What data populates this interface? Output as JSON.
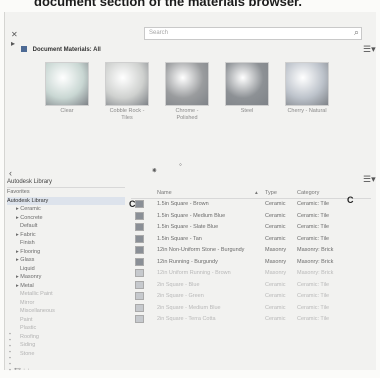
{
  "caption": "document section of the materials browser.",
  "search": {
    "placeholder": "Search"
  },
  "doc_section": {
    "title": "Document Materials: All"
  },
  "doc_materials": [
    {
      "name": "Clear",
      "color": "#c9d7d3"
    },
    {
      "name": "Cobble Rock - Tiles",
      "color": "#cfd1cf"
    },
    {
      "name": "Chrome - Polished",
      "color": "#9a9c9e"
    },
    {
      "name": "Steel",
      "color": "#8d9195"
    },
    {
      "name": "Cherry - Natural",
      "color": "#bdc3cb"
    }
  ],
  "library": {
    "title": "Autodesk Library",
    "tree": [
      {
        "label": "Favorites",
        "indent": 0,
        "selected": false,
        "faded": false
      },
      {
        "label": "Autodesk Library",
        "indent": 0,
        "selected": true,
        "faded": false
      },
      {
        "label": "▸ Ceramic",
        "indent": 1,
        "selected": false,
        "faded": false
      },
      {
        "label": "▸ Concrete",
        "indent": 1,
        "selected": false,
        "faded": false
      },
      {
        "label": "Default",
        "indent": 2,
        "selected": false,
        "faded": false
      },
      {
        "label": "▸ Fabric",
        "indent": 1,
        "selected": false,
        "faded": false
      },
      {
        "label": "Finish",
        "indent": 2,
        "selected": false,
        "faded": false
      },
      {
        "label": "▸ Flooring",
        "indent": 1,
        "selected": false,
        "faded": false
      },
      {
        "label": "▸ Glass",
        "indent": 1,
        "selected": false,
        "faded": false
      },
      {
        "label": "Liquid",
        "indent": 2,
        "selected": false,
        "faded": false
      },
      {
        "label": "▸ Masonry",
        "indent": 1,
        "selected": false,
        "faded": false
      },
      {
        "label": "▸ Metal",
        "indent": 1,
        "selected": false,
        "faded": false
      },
      {
        "label": "Metallic Paint",
        "indent": 2,
        "selected": false,
        "faded": true
      },
      {
        "label": "Mirror",
        "indent": 2,
        "selected": false,
        "faded": true
      },
      {
        "label": "Miscellaneous",
        "indent": 2,
        "selected": false,
        "faded": true
      },
      {
        "label": "Paint",
        "indent": 2,
        "selected": false,
        "faded": true
      },
      {
        "label": "Plastic",
        "indent": 2,
        "selected": false,
        "faded": true
      },
      {
        "label": "Roofing",
        "indent": 2,
        "selected": false,
        "faded": true
      },
      {
        "label": "Siding",
        "indent": 2,
        "selected": false,
        "faded": true
      },
      {
        "label": "Stone",
        "indent": 2,
        "selected": false,
        "faded": true
      }
    ]
  },
  "columns": {
    "name": "Name",
    "type": "Type",
    "category": "Category"
  },
  "rows": [
    {
      "name": "1.5in Square - Brown",
      "type": "Ceramic",
      "category": "Ceramic: Tile",
      "faded": false
    },
    {
      "name": "1.5in Square - Medium Blue",
      "type": "Ceramic",
      "category": "Ceramic: Tile",
      "faded": false
    },
    {
      "name": "1.5in Square - Slate Blue",
      "type": "Ceramic",
      "category": "Ceramic: Tile",
      "faded": false
    },
    {
      "name": "1.5in Square - Tan",
      "type": "Ceramic",
      "category": "Ceramic: Tile",
      "faded": false
    },
    {
      "name": "12in Non-Uniform Stone - Burgundy",
      "type": "Masonry",
      "category": "Masonry: Brick",
      "faded": false
    },
    {
      "name": "12in Running - Burgundy",
      "type": "Masonry",
      "category": "Masonry: Brick",
      "faded": false
    },
    {
      "name": "12in Uniform Running - Brown",
      "type": "Masonry",
      "category": "Masonry: Brick",
      "faded": true
    },
    {
      "name": "2in Square - Blue",
      "type": "Ceramic",
      "category": "Ceramic: Tile",
      "faded": true
    },
    {
      "name": "2in Square - Green",
      "type": "Ceramic",
      "category": "Ceramic: Tile",
      "faded": true
    },
    {
      "name": "2in Square - Medium Blue",
      "type": "Ceramic",
      "category": "Ceramic: Tile",
      "faded": true
    },
    {
      "name": "2in Square - Terra Cotta",
      "type": "Ceramic",
      "category": "Ceramic: Tile",
      "faded": true
    }
  ]
}
